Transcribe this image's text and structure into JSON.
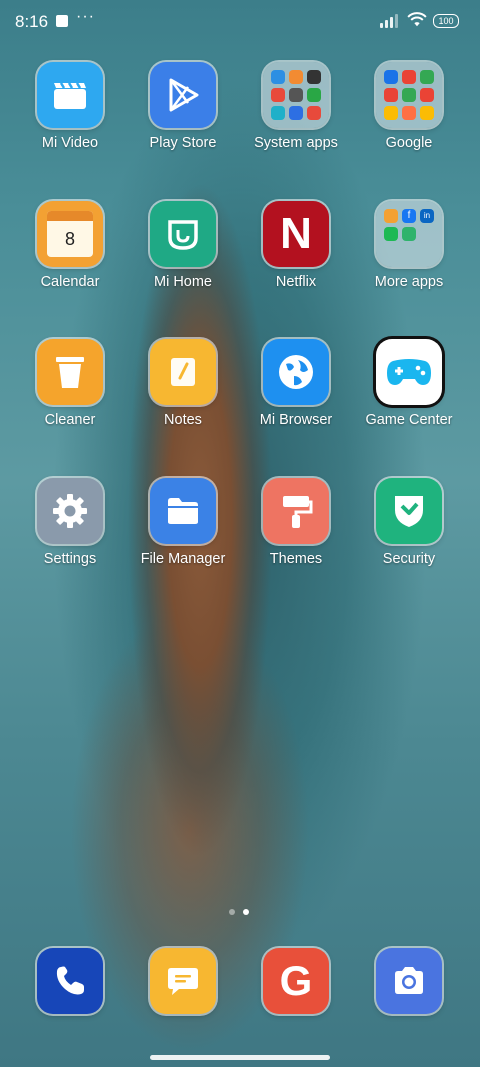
{
  "status": {
    "time": "8:16",
    "overflow": "···",
    "battery": "100",
    "icons": [
      "notification-square-icon",
      "signal-icon",
      "wifi-icon",
      "battery-icon"
    ]
  },
  "apps": [
    {
      "label": "Mi Video",
      "icon": "clapperboard-icon",
      "color": "#2ea8f0"
    },
    {
      "label": "Play Store",
      "icon": "play-triangle-icon",
      "color": "#3b7fe8"
    },
    {
      "label": "System apps",
      "icon": "folder-icon"
    },
    {
      "label": "Google",
      "icon": "folder-icon"
    },
    {
      "label": "Calendar",
      "icon": "calendar-icon",
      "color": "#f3a133",
      "date": "8"
    },
    {
      "label": "Mi Home",
      "icon": "mi-home-icon",
      "color": "#1fa985"
    },
    {
      "label": "Netflix",
      "icon": "netflix-n-icon",
      "color": "#b3111f",
      "glyph": "N"
    },
    {
      "label": "More apps",
      "icon": "folder-icon"
    },
    {
      "label": "Cleaner",
      "icon": "trash-can-icon",
      "color": "#f5a42c"
    },
    {
      "label": "Notes",
      "icon": "note-pencil-icon",
      "color": "#f7b731"
    },
    {
      "label": "Mi Browser",
      "icon": "globe-icon",
      "color": "#1e90f0"
    },
    {
      "label": "Game Center",
      "icon": "gamepad-icon",
      "color": "#ffffff"
    },
    {
      "label": "Settings",
      "icon": "gear-icon",
      "color": "#8a9aab"
    },
    {
      "label": "File Manager",
      "icon": "folder-file-icon",
      "color": "#3b82e6"
    },
    {
      "label": "Themes",
      "icon": "paint-roller-icon",
      "color": "#ee7462"
    },
    {
      "label": "Security",
      "icon": "shield-check-icon",
      "color": "#1fb37e"
    }
  ],
  "more_apps_glyphs": [
    "f",
    "in"
  ],
  "dock": [
    {
      "name": "phone",
      "icon": "phone-icon",
      "color": "#1746b8"
    },
    {
      "name": "messages",
      "icon": "message-icon",
      "color": "#f7b731"
    },
    {
      "name": "google-search",
      "icon": "google-g-icon",
      "color": "#e8503a",
      "glyph": "G"
    },
    {
      "name": "camera",
      "icon": "camera-icon",
      "color": "#4a74e0"
    }
  ],
  "pages": {
    "count": 2,
    "current": 2
  }
}
